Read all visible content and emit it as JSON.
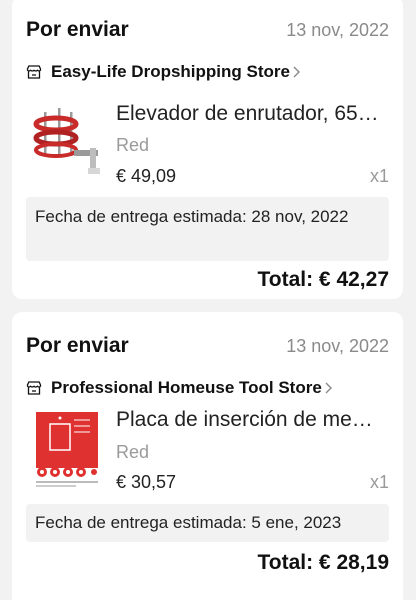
{
  "orders": [
    {
      "status": "Por enviar",
      "date": "13 nov, 2022",
      "store": "Easy-Life Dropshipping Store",
      "product_title": "Elevador de enrutador, 65…",
      "variant": "Red",
      "price": "€ 49,09",
      "quantity": "x1",
      "delivery": "Fecha de entrega estimada: 28 nov, 2022",
      "total": "Total: € 42,27"
    },
    {
      "status": "Por enviar",
      "date": "13 nov, 2022",
      "store": "Professional Homeuse Tool Store",
      "product_title": "Placa de inserción de me…",
      "variant": "Red",
      "price": "€ 30,57",
      "quantity": "x1",
      "delivery": "Fecha de entrega estimada: 5 ene, 2023",
      "total": "Total: € 28,19"
    }
  ]
}
